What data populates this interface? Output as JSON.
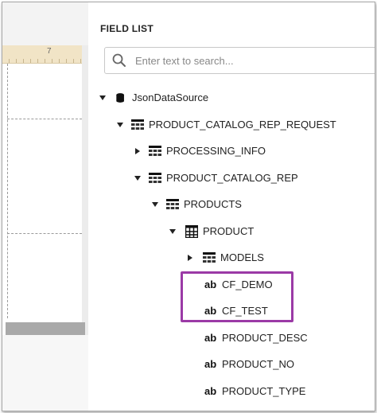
{
  "canvas": {
    "ruler_number": "7"
  },
  "field_list": {
    "title": "FIELD LIST",
    "search_placeholder": "Enter text to search..."
  },
  "tree": {
    "root": "JsonDataSource",
    "request": "PRODUCT_CATALOG_REP_REQUEST",
    "processing_info": "PROCESSING_INFO",
    "catalog_rep": "PRODUCT_CATALOG_REP",
    "products": "PRODUCTS",
    "product": "PRODUCT",
    "models": "MODELS",
    "field_type_label": "ab",
    "fields": [
      "CF_DEMO",
      "CF_TEST",
      "PRODUCT_DESC",
      "PRODUCT_NO",
      "PRODUCT_TYPE"
    ]
  },
  "colors": {
    "highlight": "#9b3aa6",
    "ruler": "#f1e4c6"
  }
}
